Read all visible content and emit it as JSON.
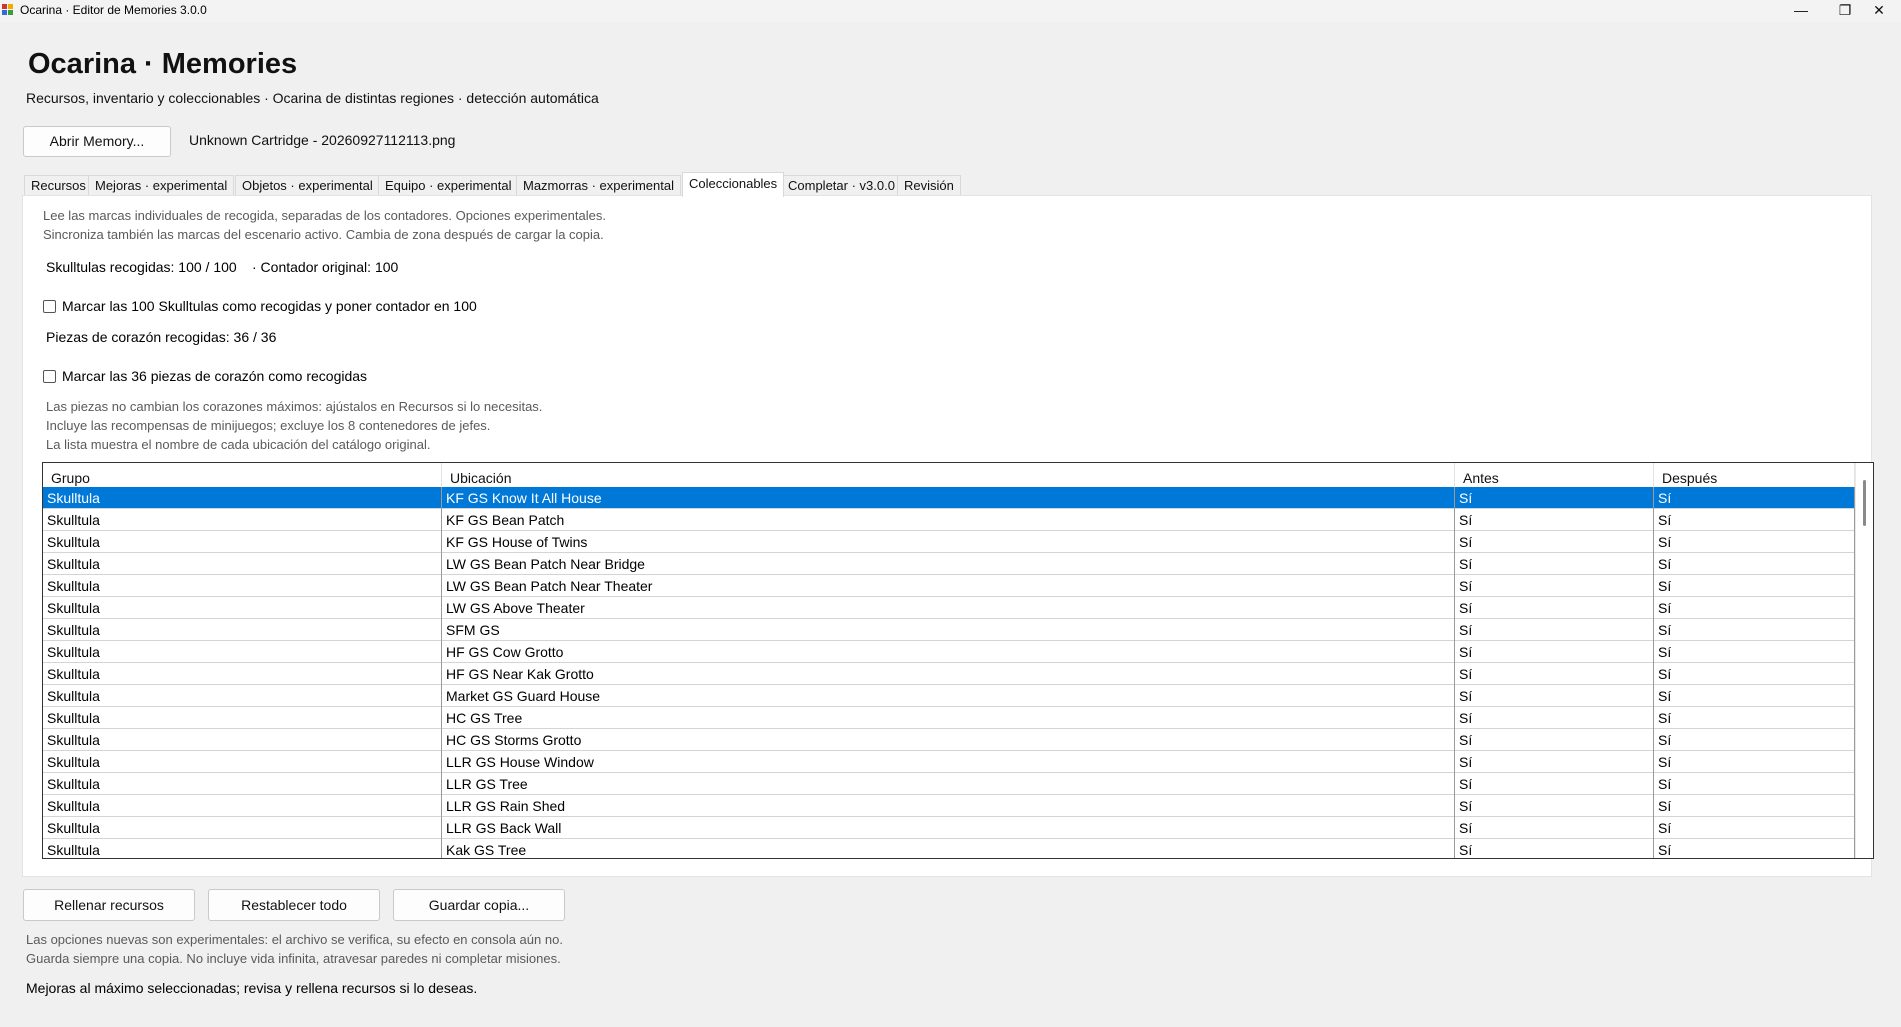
{
  "window": {
    "title": "Ocarina · Editor de Memories 3.0.0",
    "minimize_glyph": "—",
    "maximize_glyph": "❐",
    "close_glyph": "✕"
  },
  "header": {
    "title": "Ocarina · Memories",
    "subtitle": "Recursos, inventario y coleccionables · Ocarina de distintas regiones · detección automática"
  },
  "file": {
    "open_button": "Abrir Memory...",
    "current_file": "Unknown Cartridge - 20260927112113.png"
  },
  "tabs": [
    {
      "label": "Recursos"
    },
    {
      "label": "Mejoras · experimental"
    },
    {
      "label": "Objetos · experimental"
    },
    {
      "label": "Equipo · experimental"
    },
    {
      "label": "Mazmorras · experimental"
    },
    {
      "label": "Coleccionables",
      "active": true
    },
    {
      "label": "Completar · v3.0.0"
    },
    {
      "label": "Revisión"
    }
  ],
  "collectibles": {
    "intro_line1": "Lee las marcas individuales de recogida, separadas de los contadores. Opciones experimentales.",
    "intro_line2": "Sincroniza también las marcas del escenario activo. Cambia de zona después de cargar la copia.",
    "skulltulas_status": "Skulltulas recogidas: 100 / 100",
    "original_counter": "· Contador original: 100",
    "mark_skulltulas_label": "Marcar las 100 Skulltulas como recogidas y poner contador en 100",
    "mark_skulltulas_checked": false,
    "hearts_status": "Piezas de corazón recogidas: 36 / 36",
    "mark_hearts_label": "Marcar las 36 piezas de corazón como recogidas",
    "mark_hearts_checked": false,
    "note_line1": "Las piezas no cambian los corazones máximos: ajústalos en Recursos si lo necesitas.",
    "note_line2": "Incluye las recompensas de minijuegos; excluye los 8 contenedores de jefes.",
    "note_line3": "La lista muestra el nombre de cada ubicación del catálogo original."
  },
  "table": {
    "columns": [
      "Grupo",
      "Ubicación",
      "Antes",
      "Después"
    ],
    "selected_row": 0,
    "rows": [
      [
        "Skulltula",
        "KF GS Know It All House",
        "Sí",
        "Sí"
      ],
      [
        "Skulltula",
        "KF GS Bean Patch",
        "Sí",
        "Sí"
      ],
      [
        "Skulltula",
        "KF GS House of Twins",
        "Sí",
        "Sí"
      ],
      [
        "Skulltula",
        "LW GS Bean Patch Near Bridge",
        "Sí",
        "Sí"
      ],
      [
        "Skulltula",
        "LW GS Bean Patch Near Theater",
        "Sí",
        "Sí"
      ],
      [
        "Skulltula",
        "LW GS Above Theater",
        "Sí",
        "Sí"
      ],
      [
        "Skulltula",
        "SFM GS",
        "Sí",
        "Sí"
      ],
      [
        "Skulltula",
        "HF GS Cow Grotto",
        "Sí",
        "Sí"
      ],
      [
        "Skulltula",
        "HF GS Near Kak Grotto",
        "Sí",
        "Sí"
      ],
      [
        "Skulltula",
        "Market GS Guard House",
        "Sí",
        "Sí"
      ],
      [
        "Skulltula",
        "HC GS Tree",
        "Sí",
        "Sí"
      ],
      [
        "Skulltula",
        "HC GS Storms Grotto",
        "Sí",
        "Sí"
      ],
      [
        "Skulltula",
        "LLR GS House Window",
        "Sí",
        "Sí"
      ],
      [
        "Skulltula",
        "LLR GS Tree",
        "Sí",
        "Sí"
      ],
      [
        "Skulltula",
        "LLR GS Rain Shed",
        "Sí",
        "Sí"
      ],
      [
        "Skulltula",
        "LLR GS Back Wall",
        "Sí",
        "Sí"
      ],
      [
        "Skulltula",
        "Kak GS Tree",
        "Sí",
        "Sí"
      ]
    ]
  },
  "footer": {
    "fill_button": "Rellenar recursos",
    "reset_button": "Restablecer todo",
    "save_button": "Guardar copia...",
    "note_line1": "Las opciones nuevas son experimentales: el archivo se verifica, su efecto en consola aún no.",
    "note_line2": "Guarda siempre una copia. No incluye vida infinita, atravesar paredes ni completar misiones.",
    "status": "Mejoras al máximo seleccionadas; revisa y rellena recursos si lo deseas."
  },
  "colors": {
    "selection": "#0078d7",
    "app_icon": [
      "#d0342c",
      "#f2a900",
      "#2f6fd1",
      "#3a9d3a"
    ]
  }
}
